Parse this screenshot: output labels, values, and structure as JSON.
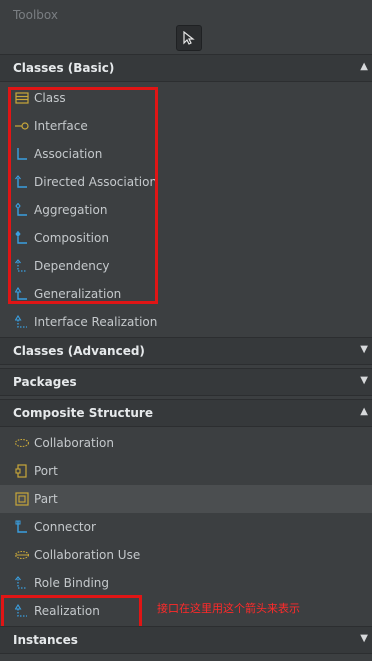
{
  "toolbox_title": "Toolbox",
  "sections": {
    "classes_basic": "Classes (Basic)",
    "classes_advanced": "Classes (Advanced)",
    "packages": "Packages",
    "composite_structure": "Composite Structure",
    "instances": "Instances"
  },
  "classes_basic_items": [
    "Class",
    "Interface",
    "Association",
    "Directed Association",
    "Aggregation",
    "Composition",
    "Dependency",
    "Generalization",
    "Interface Realization"
  ],
  "composite_items": [
    "Collaboration",
    "Port",
    "Part",
    "Connector",
    "Collaboration Use",
    "Role Binding",
    "Realization"
  ],
  "annotation": "接口在这里用这个箭头来表示",
  "colors": {
    "accent": "#3a9fe0",
    "annotation": "#e01515",
    "class_icon": "#c8a73a"
  }
}
